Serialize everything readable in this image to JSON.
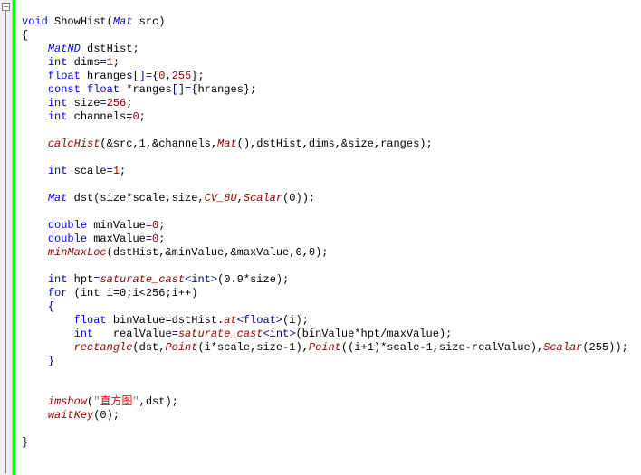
{
  "code": {
    "fn_decl_void": "void",
    "fn_decl_name": "ShowHist",
    "fn_param_type": "Mat",
    "fn_param_name": "src",
    "decl_matnd": "MatND",
    "var_dstHist": "dstHist",
    "decl_int": "int",
    "var_dims": "dims",
    "eq": "=",
    "lit_1": "1",
    "decl_float": "float",
    "var_hranges": "hranges",
    "arr_braces": "[]=",
    "lit_0": "0",
    "lit_255": "255",
    "decl_const": "const",
    "var_ranges": "*ranges",
    "var_size": "size",
    "lit_256": "256",
    "var_channels": "channels",
    "fn_calcHist": "calcHist",
    "args_calcHist": "(&src,1,&channels,",
    "fn_Mat": "Mat",
    "args_calcHist2": "(),dstHist,dims,&size,ranges);",
    "var_scale": "scale",
    "fn_MatDst": "Mat",
    "var_dst": "dst",
    "args_dst_open": "(size*scale,size,",
    "CV_8U": "CV_8U",
    "fn_Scalar": "Scalar",
    "args_scalar0": "(0));",
    "decl_double": "double",
    "var_minValue": "minValue",
    "var_maxValue": "maxValue",
    "fn_minMaxLoc": "minMaxLoc",
    "args_minMaxLoc": "(dstHist,&minValue,&maxValue,0,0);",
    "var_hpt": "hpt",
    "fn_saturate_cast": "saturate_cast",
    "tpl_int": "<int>",
    "args_hpt": "(0.9*size);",
    "kw_for": "for",
    "for_cond": "(int i=0;i<256;i++)",
    "var_binValue": "binValue",
    "eq_at": "=dstHist.",
    "fn_at": "at",
    "tpl_float": "<float>",
    "args_at": "(i);",
    "var_realValue": "realValue",
    "args_real": "(binValue*hpt/maxValue);",
    "fn_rectangle": "rectangle",
    "args_rect_open": "(dst,",
    "fn_Point": "Point",
    "args_p1": "(i*scale,size-1),",
    "args_p2": "((i+1)*scale-1,size-realValue),",
    "args_scalar255": "(255));",
    "fn_imshow": "imshow",
    "str_quote": "\"",
    "str_hist": "直方图",
    "args_imshow_end": ",dst);",
    "fn_waitKey": "waitKey",
    "args_wait": "(0);"
  }
}
